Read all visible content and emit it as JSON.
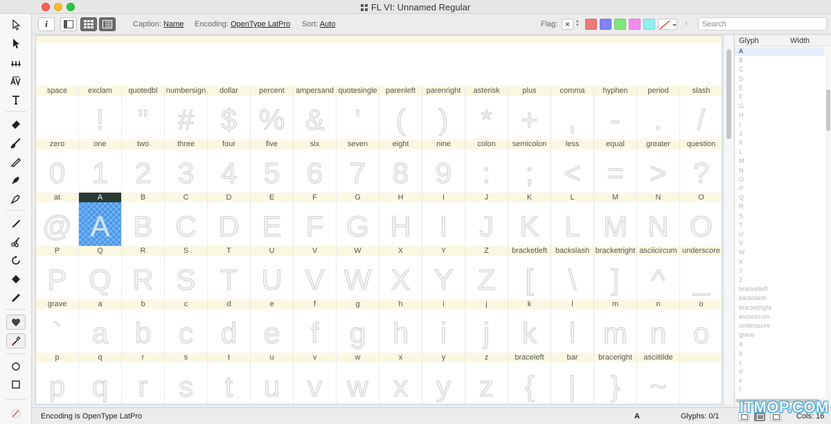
{
  "window": {
    "title": "FL VI:  Unnamed Regular"
  },
  "toolbar": {
    "info_label": "i",
    "caption_label": "Caption:",
    "caption_value": "Name",
    "encoding_label": "Encoding:",
    "encoding_value": "OpenType LatPro",
    "sort_label": "Sort:",
    "sort_value": "Auto",
    "flag_label": "Flag:",
    "flag_none": "×",
    "flag_colors": [
      "#f07a7a",
      "#8183f5",
      "#7fe67a",
      "#f28cf0",
      "#8ef0f0"
    ],
    "search_placeholder": "Search"
  },
  "grid": {
    "selected": "A",
    "rows": [
      {
        "names": [
          "space",
          "exclam",
          "quotedbl",
          "numbersign",
          "dollar",
          "percent",
          "ampersand",
          "quotesingle",
          "parenleft",
          "parenright",
          "asterisk",
          "plus",
          "comma",
          "hyphen",
          "period",
          "slash"
        ],
        "glyphs": [
          "",
          "!",
          "\"",
          "#",
          "$",
          "%",
          "&",
          "'",
          "(",
          ")",
          "*",
          "+",
          ",",
          "-",
          ".",
          "/"
        ]
      },
      {
        "names": [
          "zero",
          "one",
          "two",
          "three",
          "four",
          "five",
          "six",
          "seven",
          "eight",
          "nine",
          "colon",
          "semicolon",
          "less",
          "equal",
          "greater",
          "question"
        ],
        "glyphs": [
          "0",
          "1",
          "2",
          "3",
          "4",
          "5",
          "6",
          "7",
          "8",
          "9",
          ":",
          ";",
          "<",
          "=",
          ">",
          "?"
        ]
      },
      {
        "names": [
          "at",
          "A",
          "B",
          "C",
          "D",
          "E",
          "F",
          "G",
          "H",
          "I",
          "J",
          "K",
          "L",
          "M",
          "N",
          "O"
        ],
        "glyphs": [
          "@",
          "A",
          "B",
          "C",
          "D",
          "E",
          "F",
          "G",
          "H",
          "I",
          "J",
          "K",
          "L",
          "M",
          "N",
          "O"
        ]
      },
      {
        "names": [
          "P",
          "Q",
          "R",
          "S",
          "T",
          "U",
          "V",
          "W",
          "X",
          "Y",
          "Z",
          "bracketleft",
          "backslash",
          "bracketright",
          "asciicircum",
          "underscore"
        ],
        "glyphs": [
          "P",
          "Q",
          "R",
          "S",
          "T",
          "U",
          "V",
          "W",
          "X",
          "Y",
          "Z",
          "[",
          "\\",
          "]",
          "^",
          "_"
        ]
      },
      {
        "names": [
          "grave",
          "a",
          "b",
          "c",
          "d",
          "e",
          "f",
          "g",
          "h",
          "i",
          "j",
          "k",
          "l",
          "m",
          "n",
          "o"
        ],
        "glyphs": [
          "`",
          "a",
          "b",
          "c",
          "d",
          "e",
          "f",
          "g",
          "h",
          "i",
          "j",
          "k",
          "l",
          "m",
          "n",
          "o"
        ]
      },
      {
        "names": [
          "p",
          "q",
          "r",
          "s",
          "t",
          "u",
          "v",
          "w",
          "x",
          "y",
          "z",
          "braceleft",
          "bar",
          "braceright",
          "asciitilde",
          ""
        ],
        "glyphs": [
          "p",
          "q",
          "r",
          "s",
          "t",
          "u",
          "v",
          "w",
          "x",
          "y",
          "z",
          "{",
          "|",
          "}",
          "~",
          ""
        ]
      }
    ]
  },
  "panel": {
    "col_glyph": "Glyph",
    "col_width": "Width",
    "rows": [
      "A",
      "B",
      "C",
      "D",
      "E",
      "F",
      "G",
      "H",
      "I",
      "J",
      "K",
      "L",
      "M",
      "N",
      "O",
      "P",
      "Q",
      "R",
      "S",
      "T",
      "U",
      "V",
      "W",
      "X",
      "Y",
      "Z",
      "bracketleft",
      "backslash",
      "bracketright",
      "asciicircum",
      "underscore",
      "grave",
      "a",
      "b",
      "c",
      "d",
      "e",
      "f"
    ]
  },
  "status": {
    "encoding_text": "Encoding is OpenType LatPro",
    "current_glyph": "A",
    "glyph_count": "Glyphs: 0/1",
    "cols": "Cols: 16"
  },
  "watermark": "ITMOP.COM"
}
